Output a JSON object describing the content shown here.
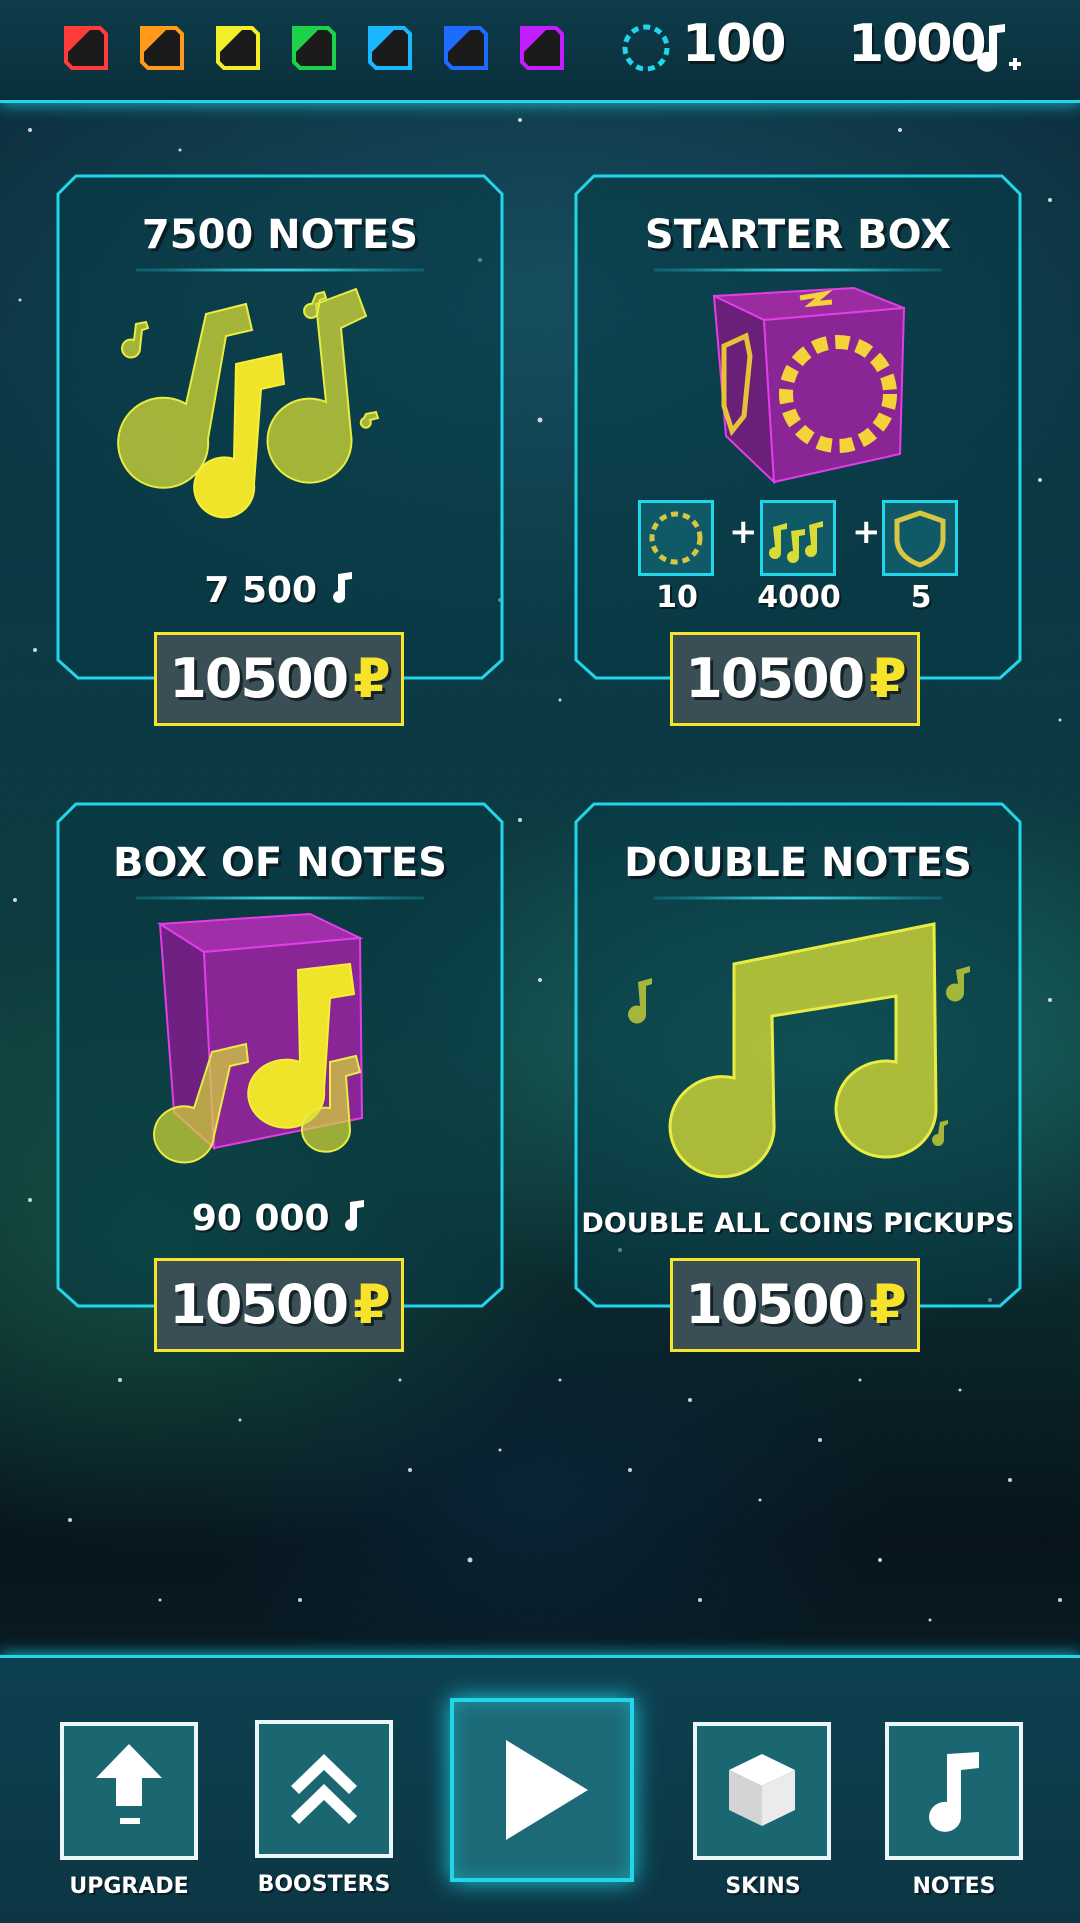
{
  "topbar": {
    "gems": [
      {
        "icon": "red-gem-icon",
        "color": "#ff3b3b"
      },
      {
        "icon": "orange-gem-icon",
        "color": "#ff9a1a"
      },
      {
        "icon": "yellow-gem-icon",
        "color": "#f4ee2a"
      },
      {
        "icon": "green-gem-icon",
        "color": "#1ed14a"
      },
      {
        "icon": "cyan-gem-icon",
        "color": "#1ab7ff"
      },
      {
        "icon": "blue-gem-icon",
        "color": "#1d6bff"
      },
      {
        "icon": "purple-gem-icon",
        "color": "#c21dff"
      }
    ],
    "coins": "100",
    "notes": "1000"
  },
  "cards": [
    {
      "title": "7500 NOTES",
      "amount": "7 500",
      "price": "10500",
      "currency": "₽"
    },
    {
      "title": "STARTER BOX",
      "items": [
        {
          "value": "10",
          "icon": "coin-ring-icon"
        },
        {
          "value": "4000",
          "icon": "notes-icon"
        },
        {
          "value": "5",
          "icon": "shield-icon"
        }
      ],
      "price": "10500",
      "currency": "₽"
    },
    {
      "title": "BOX OF NOTES",
      "amount": "90 000",
      "price": "10500",
      "currency": "₽"
    },
    {
      "title": "DOUBLE  NOTES",
      "description": "DOUBLE ALL COINS PICKUPS",
      "price": "10500",
      "currency": "₽"
    }
  ],
  "nav": {
    "upgrade": "UPGRADE",
    "boosters": "BOOSTERS",
    "skins": "SKINS",
    "notes": "NOTES"
  },
  "colors": {
    "accent": "#21d6ea",
    "price_border": "#f7e32a",
    "note": "#d8dc34",
    "box": "#c02fc2"
  }
}
